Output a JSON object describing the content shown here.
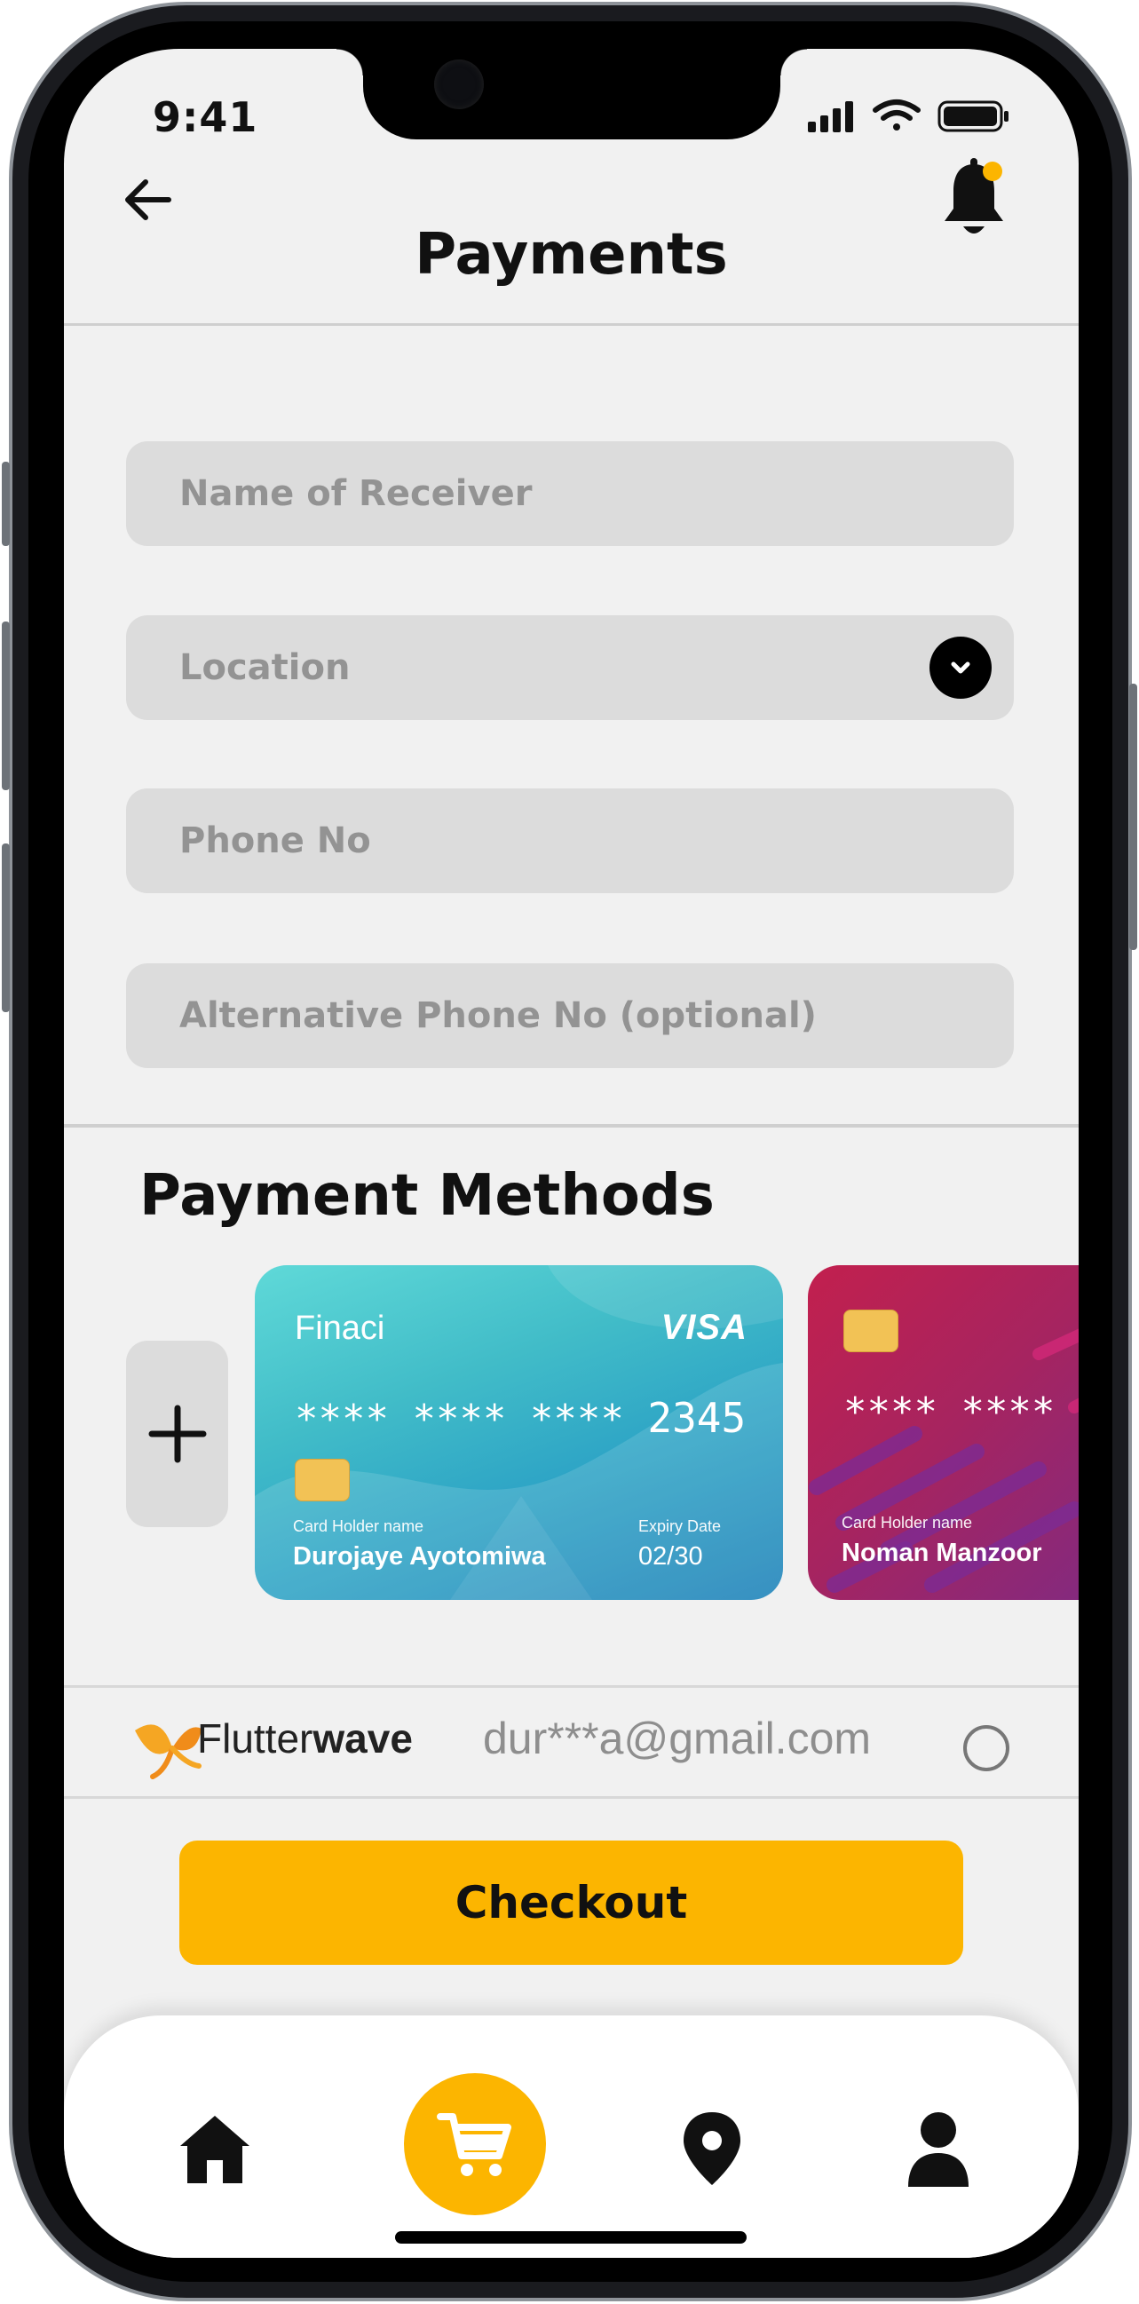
{
  "status_bar": {
    "time": "9:41"
  },
  "header": {
    "title": "Payments"
  },
  "form": {
    "name_placeholder": "Name of Receiver",
    "location_placeholder": "Location",
    "phone_placeholder": "Phone No",
    "alt_phone_placeholder": "Alternative Phone No (optional)"
  },
  "payment_methods": {
    "title": "Payment Methods",
    "cards": [
      {
        "brand": "Finaci",
        "network": "VISA",
        "masked": "**** **** ****",
        "last4": "2345",
        "holder_label": "Card Holder name",
        "holder": "Durojaye Ayotomiwa",
        "expiry_label": "Expiry Date",
        "expiry": "02/30"
      },
      {
        "masked": "**** **** ****",
        "holder_label": "Card Holder name",
        "holder": "Noman Manzoor"
      }
    ],
    "flutterwave": {
      "brand_light": "Flutter",
      "brand_bold": "wave",
      "email": "dur***a@gmail.com"
    }
  },
  "checkout_label": "Checkout",
  "bottom_nav": {
    "items": [
      "home-icon",
      "cart-icon",
      "location-pin-icon",
      "profile-icon"
    ],
    "active": "cart-icon"
  },
  "colors": {
    "accent": "#fcb500",
    "background": "#f1f1f1",
    "field": "#dcdcdc",
    "notification_dot": "#fcb500"
  }
}
